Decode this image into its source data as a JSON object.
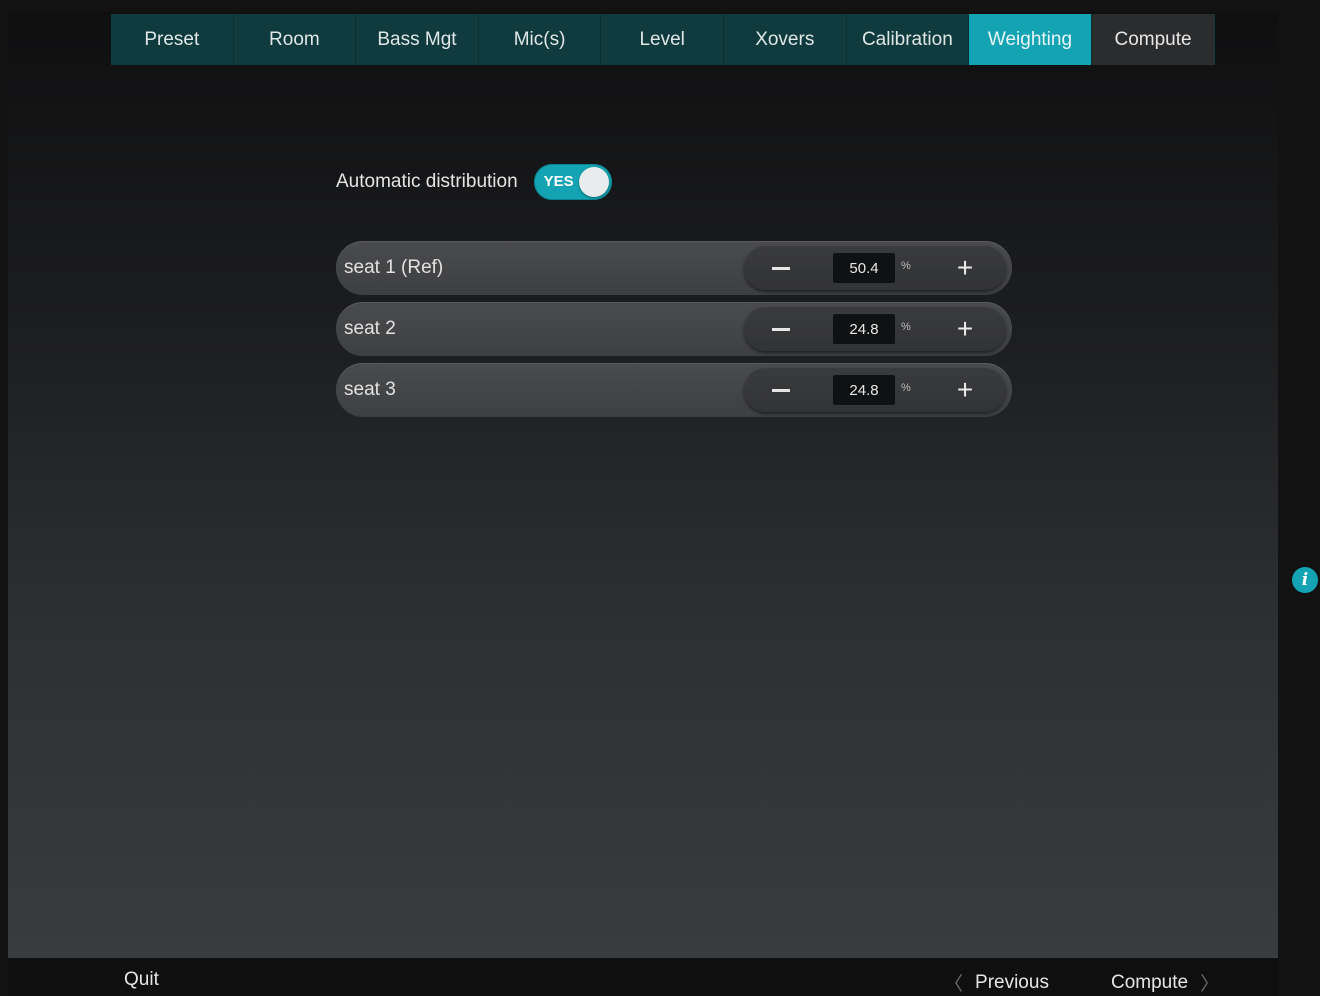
{
  "tabs": [
    {
      "label": "Preset",
      "state": "normal"
    },
    {
      "label": "Room",
      "state": "normal"
    },
    {
      "label": "Bass Mgt",
      "state": "normal"
    },
    {
      "label": "Mic(s)",
      "state": "normal"
    },
    {
      "label": "Level",
      "state": "normal"
    },
    {
      "label": "Xovers",
      "state": "normal"
    },
    {
      "label": "Calibration",
      "state": "normal"
    },
    {
      "label": "Weighting",
      "state": "active"
    },
    {
      "label": "Compute",
      "state": "normal"
    }
  ],
  "auto_distribution": {
    "label": "Automatic distribution",
    "toggle_text": "YES",
    "enabled": true
  },
  "seats": [
    {
      "label": "seat 1 (Ref)",
      "value": "50.4",
      "unit": "%"
    },
    {
      "label": "seat 2",
      "value": "24.8",
      "unit": "%"
    },
    {
      "label": "seat 3",
      "value": "24.8",
      "unit": "%"
    }
  ],
  "stepper": {
    "plus_symbol": "+"
  },
  "info": {
    "icon": "info-icon",
    "glyph": "i"
  },
  "footer": {
    "quit_label": "Quit",
    "previous_label": "Previous",
    "next_label": "Compute",
    "prev_chevron": "〈",
    "next_chevron": "〉"
  },
  "colors": {
    "accent": "#13a3b3",
    "tab_bar": "#0f3b3f",
    "row_bg": "#454648"
  }
}
